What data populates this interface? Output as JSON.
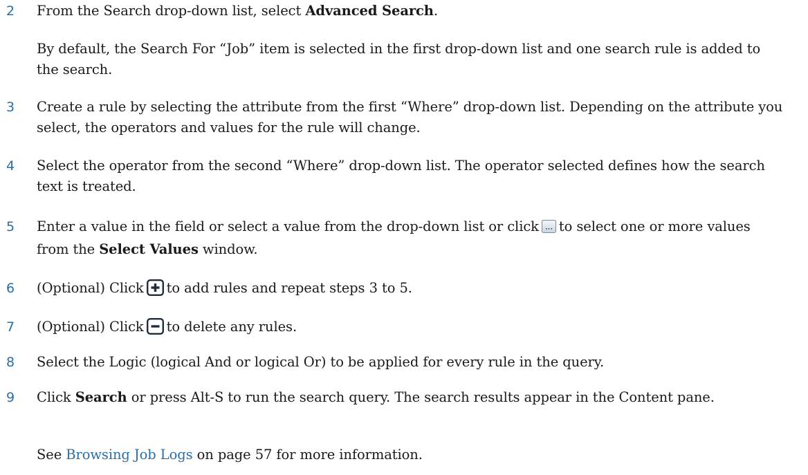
{
  "steps": [
    {
      "number": "2",
      "pre": "From the Search drop-down list, select ",
      "bold": "Advanced Search",
      "post": "."
    },
    {
      "number": "3",
      "text": "Create a rule by selecting the attribute from the first “Where” drop-down list. Depending on the attribute you select, the operators and values for the rule will change."
    },
    {
      "number": "4",
      "text": "Select the operator from the second “Where” drop-down list. The operator selected defines how the search text is treated."
    },
    {
      "number": "5",
      "pre": "Enter a value in the field or select a value from the drop-down list or click",
      "mid": "to select one or more values from the ",
      "bold": "Select Values",
      "post": " window.",
      "icon": "ellipsis-button-icon"
    },
    {
      "number": "6",
      "pre": "(Optional) Click",
      "post": "to add rules and repeat steps 3 to 5.",
      "icon": "add-rule-icon"
    },
    {
      "number": "7",
      "pre": "(Optional) Click",
      "post": "to delete any rules.",
      "icon": "delete-rule-icon"
    },
    {
      "number": "8",
      "text": "Select the Logic (logical And or logical Or) to be applied for every rule in the query."
    },
    {
      "number": "9",
      "pre": "Click ",
      "bold": "Search",
      "post": " or press Alt-S to run the search query. The search results appear in the Content pane."
    }
  ],
  "note_after_2": "By default, the Search For “Job” item is selected in the first drop-down list and one search rule is added to the search.",
  "see_also": {
    "pre": "See ",
    "link": "Browsing Job Logs",
    "mid": " on page ",
    "page": "57",
    "post": " for more information."
  },
  "colors": {
    "number": "#2a6ea6",
    "link": "#2a6ea6",
    "text": "#1a1a1a"
  }
}
